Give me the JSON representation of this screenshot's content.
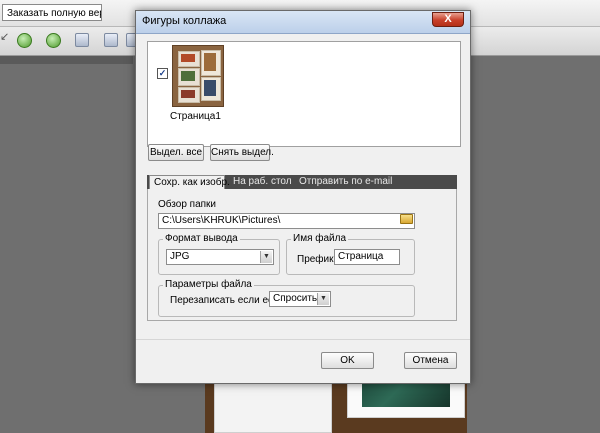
{
  "background_app": {
    "order_button_label": "Заказать полную версию..."
  },
  "dialog": {
    "title": "Фигуры коллажа",
    "close_label": "X",
    "page_thumb": {
      "label": "Страница1",
      "checked": true,
      "check_glyph": "✓"
    },
    "select_all_label": "Выдел. все",
    "deselect_label": "Снять выдел.",
    "tabs": [
      {
        "label": "Сохр. как изобр.",
        "active": true
      },
      {
        "label": "На раб. стол",
        "active": false
      },
      {
        "label": "Отправить по e-mail",
        "active": false
      }
    ],
    "browse": {
      "label": "Обзор папки",
      "path": "C:\\Users\\KHRUK\\Pictures\\"
    },
    "output_format": {
      "title": "Формат вывода",
      "value": "JPG"
    },
    "file_name": {
      "title": "Имя файла",
      "prefix_label": "Префикс",
      "prefix_value": "Страница"
    },
    "file_params": {
      "title": "Параметры файла",
      "overwrite_label": "Перезаписать если есть",
      "overwrite_value": "Спросить"
    },
    "ok_label": "OK",
    "cancel_label": "Отмена"
  }
}
